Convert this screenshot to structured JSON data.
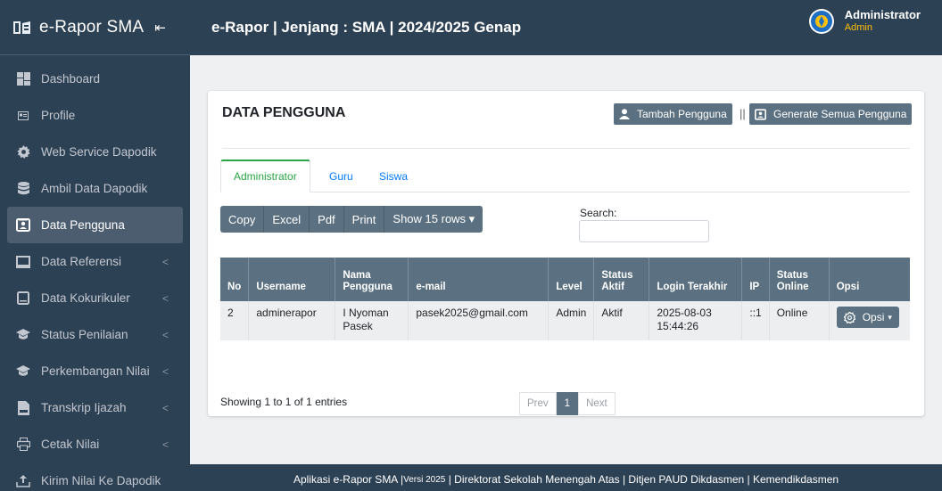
{
  "brand": {
    "name": "e-Rapor SMA",
    "collapse": "⇤"
  },
  "sidebar": {
    "items": [
      {
        "label": "Dashboard",
        "icon": "dashboard-icon",
        "active": false,
        "caret": ""
      },
      {
        "label": "Profile",
        "icon": "profile-icon",
        "active": false,
        "caret": ""
      },
      {
        "label": "Web Service Dapodik",
        "icon": "gear-icon",
        "active": false,
        "caret": ""
      },
      {
        "label": "Ambil Data Dapodik",
        "icon": "database-icon",
        "active": false,
        "caret": ""
      },
      {
        "label": "Data Pengguna",
        "icon": "user-card-icon",
        "active": true,
        "caret": ""
      },
      {
        "label": "Data Referensi",
        "icon": "monitor-icon",
        "active": false,
        "caret": "<"
      },
      {
        "label": "Data Kokurikuler",
        "icon": "tablet-icon",
        "active": false,
        "caret": "<"
      },
      {
        "label": "Status Penilaian",
        "icon": "graduation-cap-icon",
        "active": false,
        "caret": "<"
      },
      {
        "label": "Perkembangan Nilai",
        "icon": "graduation-cap-icon",
        "active": false,
        "caret": "<"
      },
      {
        "label": "Transkrip Ijazah",
        "icon": "pdf-file-icon",
        "active": false,
        "caret": "<"
      },
      {
        "label": "Cetak Nilai",
        "icon": "printer-icon",
        "active": false,
        "caret": "<"
      },
      {
        "label": "Kirim Nilai Ke Dapodik",
        "icon": "upload-icon",
        "active": false,
        "caret": ""
      }
    ]
  },
  "topbar": {
    "title": "e-Rapor | Jenjang : SMA | 2024/2025 Genap"
  },
  "user": {
    "name": "Administrator",
    "role": "Admin"
  },
  "card": {
    "title": "DATA PENGGUNA",
    "add_button": "Tambah Pengguna",
    "separator": "||",
    "generate_button": "Generate Semua Pengguna"
  },
  "tabs": [
    {
      "label": "Administrator",
      "active": true
    },
    {
      "label": "Guru",
      "active": false
    },
    {
      "label": "Siswa",
      "active": false
    }
  ],
  "dt_buttons": [
    "Copy",
    "Excel",
    "Pdf",
    "Print",
    "Show 15 rows ▾"
  ],
  "search": {
    "label": "Search:",
    "value": ""
  },
  "table": {
    "headers": [
      "No",
      "Username",
      "Nama Pengguna",
      "e-mail",
      "Level",
      "Status Aktif",
      "Login Terakhir",
      "IP",
      "Status Online",
      "Opsi"
    ],
    "rows": [
      [
        "2",
        "adminerapor",
        "I Nyoman Pasek",
        "pasek2025@gmail.com",
        "Admin",
        "Aktif",
        "2025-08-03 15:44:26",
        "::1",
        "Online",
        "Opsi"
      ]
    ]
  },
  "info": "Showing 1 to 1 of 1 entries",
  "pager": {
    "prev": "Prev",
    "current": "1",
    "next": "Next"
  },
  "footer": {
    "part1": "Aplikasi e-Rapor SMA | ",
    "version": "Versi 2025",
    "part2": " | Direktorat Sekolah Menengah Atas | Ditjen PAUD Dikdasmen | Kemendikdasmen"
  }
}
